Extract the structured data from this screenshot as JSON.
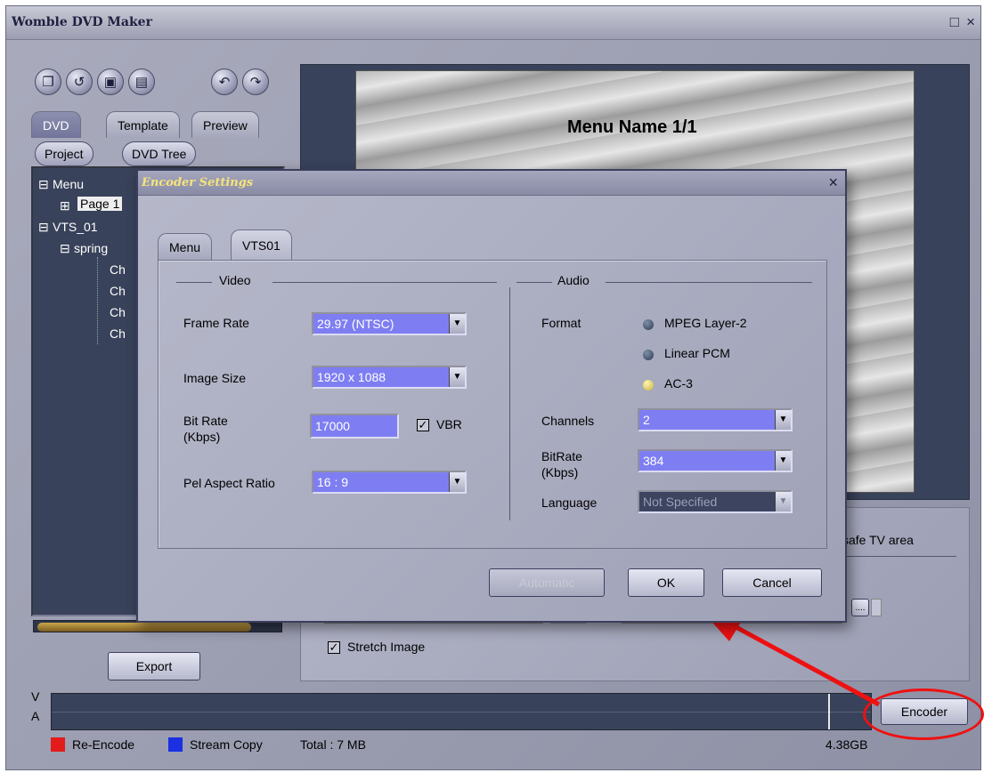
{
  "window": {
    "title": "Womble DVD Maker",
    "maximize_glyph": "□",
    "close_glyph": "×"
  },
  "toolbar": {
    "buttons": [
      {
        "name": "new-file-icon",
        "glyph": "❐"
      },
      {
        "name": "open-folder-icon",
        "glyph": "↺"
      },
      {
        "name": "save-icon",
        "glyph": "▣"
      },
      {
        "name": "save-as-icon",
        "glyph": "▤"
      },
      {
        "name": "undo-icon",
        "glyph": "↶"
      },
      {
        "name": "redo-icon",
        "glyph": "↷"
      }
    ]
  },
  "left_tabs": [
    "DVD",
    "Template",
    "Preview"
  ],
  "sub_buttons": [
    "Project",
    "DVD Tree"
  ],
  "tree": {
    "menu": "Menu",
    "page": "Page 1",
    "vts": "VTS_01",
    "spring": "spring",
    "chapters": [
      "Ch",
      "Ch",
      "Ch",
      "Ch"
    ],
    "expand_glyph": "⊟",
    "collapse_glyph": "⊞"
  },
  "export_label": "Export",
  "preview": {
    "menu_name": "Menu Name 1/1"
  },
  "lower": {
    "safe_tv_text": "safe TV area",
    "stretch_label": "Stretch Image",
    "ellipsis_label": "...."
  },
  "dialog": {
    "title": "Encoder Settings",
    "close_glyph": "×",
    "tabs": [
      "Menu",
      "VTS01"
    ],
    "video_group": "Video",
    "audio_group": "Audio",
    "frame_rate_label": "Frame Rate",
    "frame_rate_value": "29.97  (NTSC)",
    "image_size_label": "Image Size",
    "image_size_value": "1920 x 1088",
    "bitrate_label_1": "Bit Rate",
    "bitrate_label_2": "(Kbps)",
    "bitrate_value": "17000",
    "vbr_label": "VBR",
    "pel_label": "Pel Aspect Ratio",
    "pel_value": "16 : 9",
    "format_label": "Format",
    "format_options": [
      "MPEG Layer-2",
      "Linear PCM",
      "AC-3"
    ],
    "format_selected_index": 2,
    "channels_label": "Channels",
    "channels_value": "2",
    "audio_bitrate_label_1": "BitRate",
    "audio_bitrate_label_2": "(Kbps)",
    "audio_bitrate_value": "384",
    "language_label": "Language",
    "language_value": "Not Specified",
    "automatic_label": "Automatic",
    "ok_label": "OK",
    "cancel_label": "Cancel",
    "arrow_glyph": "▼"
  },
  "timeline": {
    "v_label": "V",
    "a_label": "A"
  },
  "encoder_label": "Encoder",
  "status": {
    "reencode_label": "Re-Encode",
    "reencode_color": "#e31b1b",
    "streamcopy_label": "Stream Copy",
    "streamcopy_color": "#1b2fe3",
    "total_label": "Total : 7 MB",
    "capacity_label": "4.38GB"
  },
  "colors": {
    "annotation_red": "#e11"
  }
}
